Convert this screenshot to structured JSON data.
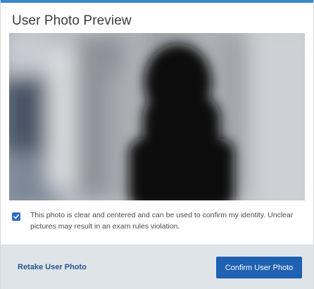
{
  "dialog": {
    "title": "User Photo Preview",
    "accent_color": "#3b86c6"
  },
  "photo": {
    "description": "blurred-user-photo"
  },
  "consent": {
    "checked": true,
    "text": "This photo is clear and centered and can be used to confirm my identity. Unclear pictures may result in an exam rules violation."
  },
  "footer": {
    "retake_label": "Retake User Photo",
    "confirm_label": "Confirm User Photo",
    "link_color": "#24558f",
    "button_color": "#1f61b2"
  }
}
